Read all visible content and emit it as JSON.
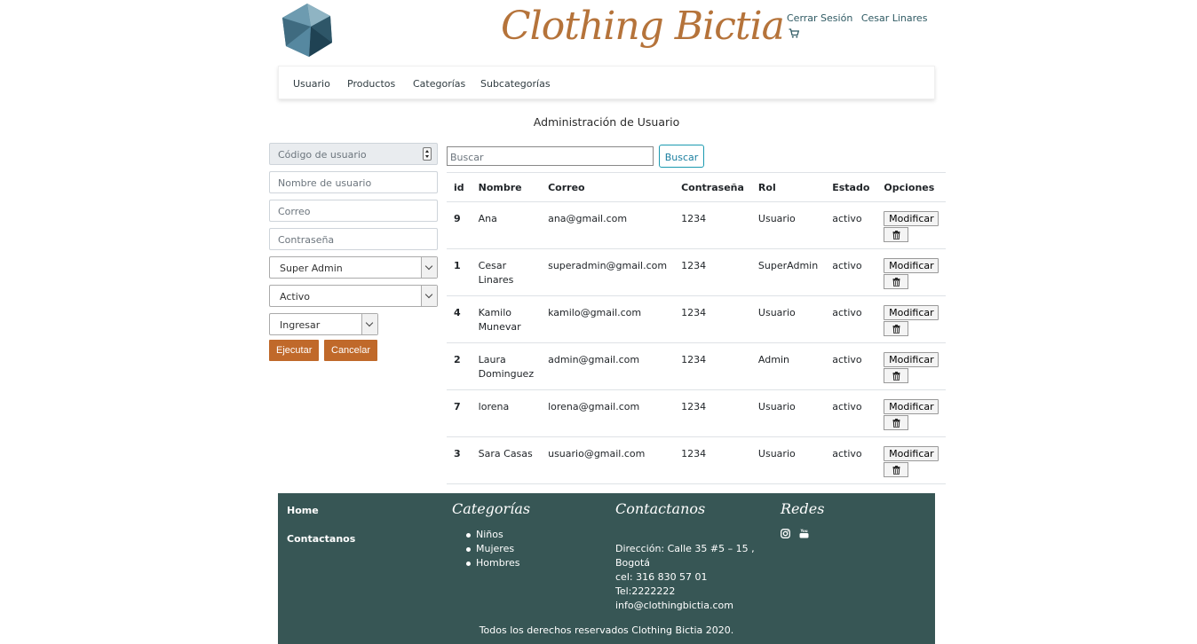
{
  "header": {
    "brand": "Clothing Bictia",
    "logout": "Cerrar Sesión",
    "username": "Cesar Linares"
  },
  "nav": [
    "Usuario",
    "Productos",
    "Categorías",
    "Subcategorías"
  ],
  "page_title": "Administración de Usuario",
  "form": {
    "code_placeholder": "Código de usuario",
    "name_placeholder": "Nombre de usuario",
    "email_placeholder": "Correo",
    "password_placeholder": "Contraseña",
    "role_selected": "Super Admin",
    "status_selected": "Activo",
    "action_selected": "Ingresar",
    "execute_label": "Ejecutar",
    "cancel_label": "Cancelar"
  },
  "search": {
    "placeholder": "Buscar",
    "button_label": "Buscar"
  },
  "table": {
    "headers": [
      "id",
      "Nombre",
      "Correo",
      "Contraseña",
      "Rol",
      "Estado",
      "Opciones"
    ],
    "modify_label": "Modificar",
    "rows": [
      {
        "id": "9",
        "name": "Ana",
        "email": "ana@gmail.com",
        "password": "1234",
        "role": "Usuario",
        "status": "activo"
      },
      {
        "id": "1",
        "name": "Cesar Linares",
        "email": "superadmin@gmail.com",
        "password": "1234",
        "role": "SuperAdmin",
        "status": "activo"
      },
      {
        "id": "4",
        "name": "Kamilo Munevar",
        "email": "kamilo@gmail.com",
        "password": "1234",
        "role": "Usuario",
        "status": "activo"
      },
      {
        "id": "2",
        "name": "Laura Dominguez",
        "email": "admin@gmail.com",
        "password": "1234",
        "role": "Admin",
        "status": "activo"
      },
      {
        "id": "7",
        "name": "lorena",
        "email": "lorena@gmail.com",
        "password": "1234",
        "role": "Usuario",
        "status": "activo"
      },
      {
        "id": "3",
        "name": "Sara Casas",
        "email": "usuario@gmail.com",
        "password": "1234",
        "role": "Usuario",
        "status": "activo"
      }
    ]
  },
  "footer": {
    "home": "Home",
    "contact_link": "Contactanos",
    "categories_title": "Categorías",
    "categories": [
      "Niños",
      "Mujeres",
      "Hombres"
    ],
    "contact_title": "Contactanos",
    "address": "Dirección: Calle 35 #5 – 15 , Bogotá",
    "cel": "cel: 316 830 57 01",
    "tel": "Tel:2222222",
    "email": "info@clothingbictia.com",
    "social_title": "Redes",
    "social_icons": [
      "instagram-icon",
      "youtube-icon"
    ],
    "copyright": "Todos los derechos reservados Clothing Bictia 2020."
  },
  "colors": {
    "brand": "#b5733a",
    "button_orange": "#c0692a",
    "footer_bg": "#375655",
    "link": "#2f5a63"
  }
}
